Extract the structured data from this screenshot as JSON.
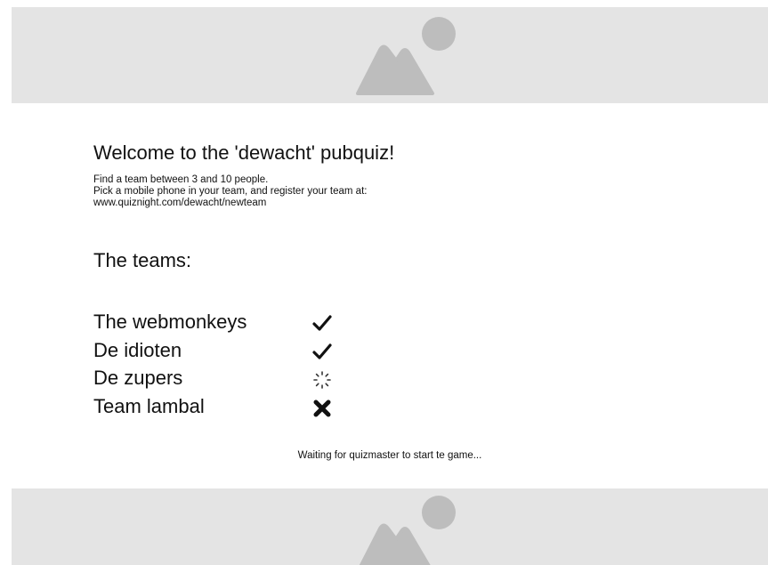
{
  "header": {
    "image_icon": "image-placeholder-icon"
  },
  "main": {
    "title": "Welcome to the 'dewacht' pubquiz!",
    "instructions": [
      "Find a team between 3 and 10 people.",
      "Pick a mobile phone in your team, and register your team at:",
      "www.quiznight.com/dewacht/newteam"
    ],
    "teams_heading": "The teams:",
    "teams": [
      {
        "name": "The webmonkeys",
        "status": "ready",
        "icon": "checkmark-icon"
      },
      {
        "name": "De idioten",
        "status": "ready",
        "icon": "checkmark-icon"
      },
      {
        "name": "De zupers",
        "status": "loading",
        "icon": "spinner-icon"
      },
      {
        "name": "Team lambal",
        "status": "failed",
        "icon": "cross-icon"
      }
    ],
    "status_message": "Waiting for quizmaster to start te game..."
  },
  "footer": {
    "image_icon": "image-placeholder-icon"
  }
}
